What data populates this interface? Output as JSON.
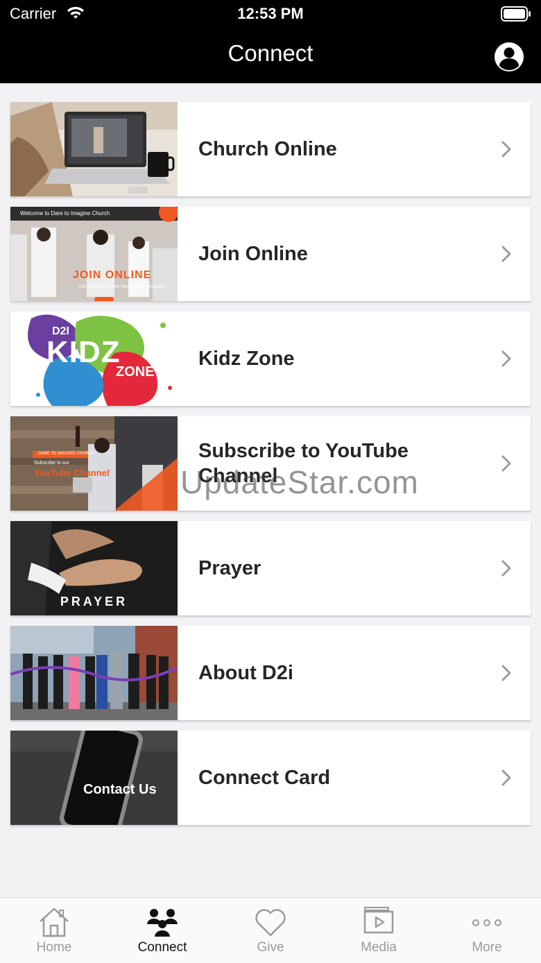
{
  "status_bar": {
    "carrier": "Carrier",
    "time": "12:53 PM"
  },
  "nav": {
    "title": "Connect",
    "profile_icon": "user-circle-icon"
  },
  "items": [
    {
      "label": "Church Online",
      "thumb": "laptop-livestream-image"
    },
    {
      "label": "Join Online",
      "thumb": "join-online-banner",
      "thumb_title": "JOIN ONLINE",
      "thumb_caption": "Life is Better When You Dare to Imagine",
      "thumb_header": "Welcome to Dare to Imagine Church"
    },
    {
      "label": "Kidz Zone",
      "thumb": "kidz-zone-logo",
      "thumb_title": "KIDZ",
      "thumb_sub": "ZONE",
      "thumb_small": "D2I"
    },
    {
      "label": "Subscribe to YouTube Channel",
      "thumb": "youtube-banner",
      "thumb_header": "DARE TO IMAGINE CHURCH",
      "thumb_sub": "Subscribe to our",
      "thumb_title": "YouTube Channel"
    },
    {
      "label": "Prayer",
      "thumb": "prayer-hands-image",
      "thumb_title": "PRAYER"
    },
    {
      "label": "About D2i",
      "thumb": "ribbon-cutting-photo"
    },
    {
      "label": "Connect Card",
      "thumb": "phone-contact-image",
      "thumb_title": "Contact Us"
    }
  ],
  "watermark": "UpdateStar.com",
  "tabs": [
    {
      "label": "Home",
      "icon": "home-icon",
      "active": false
    },
    {
      "label": "Connect",
      "icon": "people-icon",
      "active": true
    },
    {
      "label": "Give",
      "icon": "heart-icon",
      "active": false
    },
    {
      "label": "Media",
      "icon": "media-icon",
      "active": false
    },
    {
      "label": "More",
      "icon": "more-dots-icon",
      "active": false
    }
  ],
  "colors": {
    "header_bg": "#000000",
    "accent_orange": "#f05a22",
    "tab_inactive": "#9a9a9a"
  }
}
